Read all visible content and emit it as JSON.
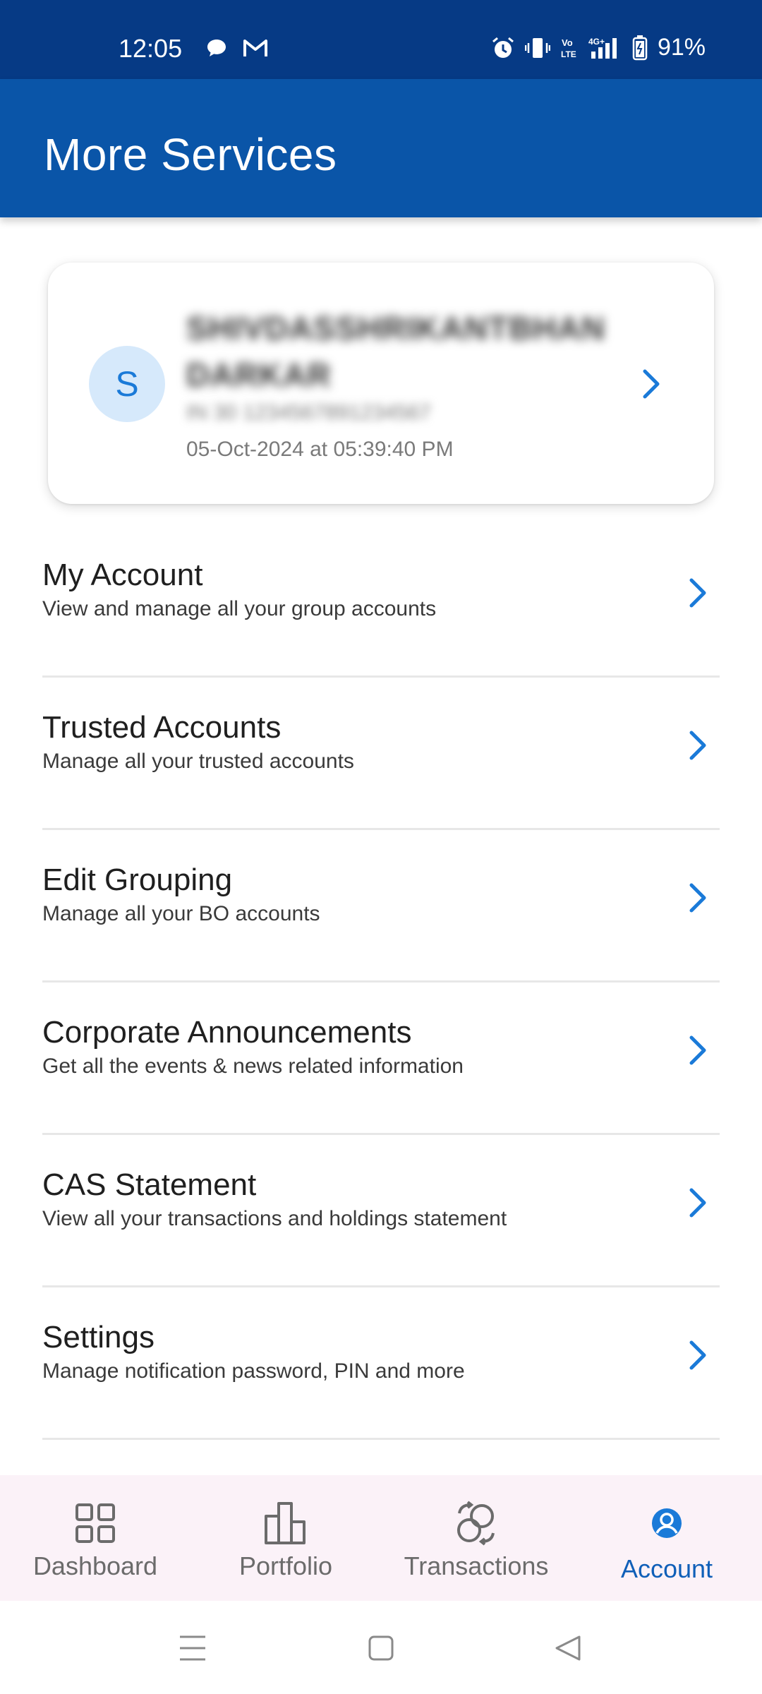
{
  "status_bar": {
    "time": "12:05",
    "battery": "91%",
    "left_icons": [
      "chat-bubble-icon",
      "gmail-icon"
    ],
    "right_icons": [
      "alarm-icon",
      "vibrate-icon",
      "volte-icon",
      "signal-4g-icon",
      "battery-icon"
    ]
  },
  "header": {
    "title": "More Services"
  },
  "profile": {
    "avatar_initial": "S",
    "name": "SHIVDASSHRIKANTBHAN DARKAR",
    "id": "IN 30 1234567891234567",
    "last_login": "05-Oct-2024 at 05:39:40 PM"
  },
  "menu": {
    "items": [
      {
        "title": "My Account",
        "subtitle": "View and manage all your group accounts"
      },
      {
        "title": "Trusted Accounts",
        "subtitle": "Manage all your trusted accounts"
      },
      {
        "title": "Edit Grouping",
        "subtitle": "Manage all your BO accounts"
      },
      {
        "title": "Corporate Announcements",
        "subtitle": "Get all the events & news related information"
      },
      {
        "title": "CAS Statement",
        "subtitle": "View all your transactions and holdings statement"
      },
      {
        "title": "Settings",
        "subtitle": "Manage notification password, PIN and more"
      }
    ]
  },
  "bottom_nav": {
    "items": [
      {
        "label": "Dashboard",
        "icon": "grid-icon"
      },
      {
        "label": "Portfolio",
        "icon": "bar-chart-icon"
      },
      {
        "label": "Transactions",
        "icon": "exchange-icon"
      },
      {
        "label": "Account",
        "icon": "account-circle-icon",
        "active": true
      }
    ]
  },
  "colors": {
    "status_bar": "#063a85",
    "app_bar": "#0a55a8",
    "accent": "#1a7ad8",
    "nav_bg": "#fbf2f8"
  }
}
